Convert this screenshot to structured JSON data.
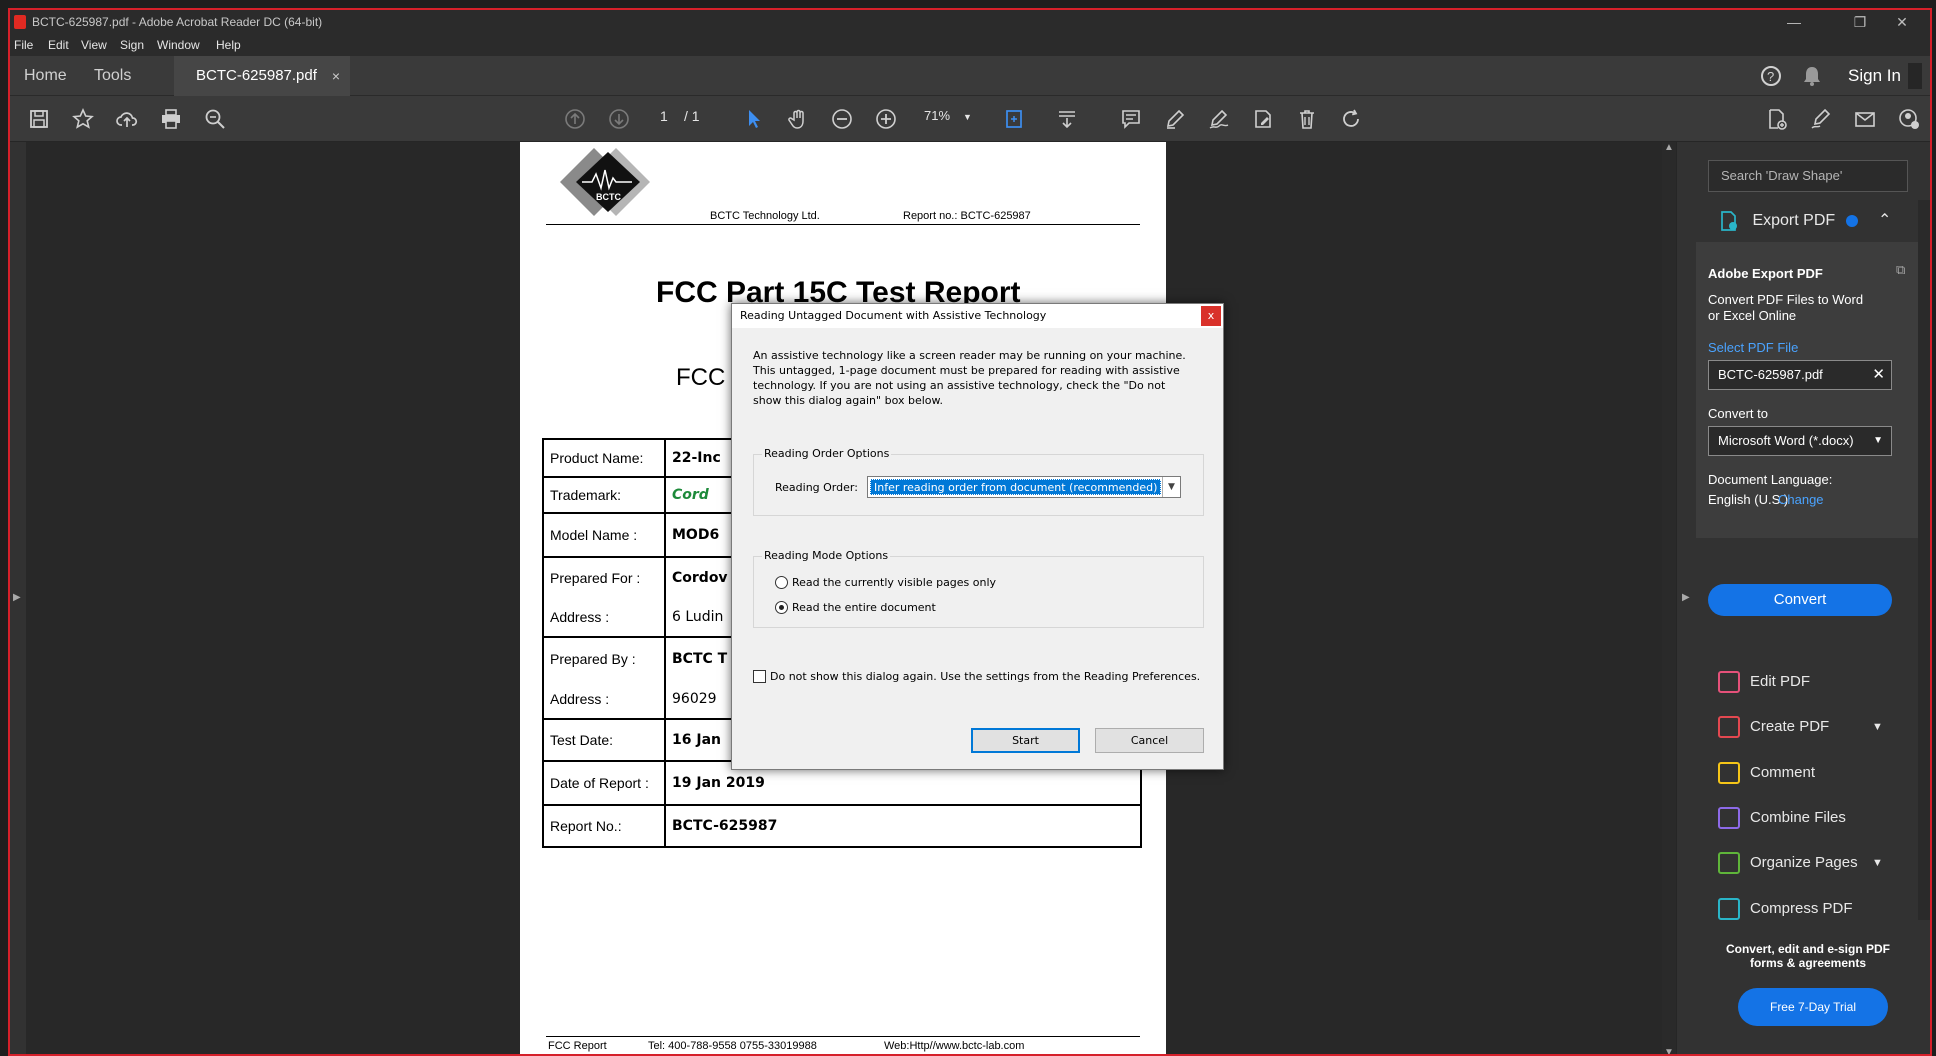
{
  "window": {
    "title": "BCTC-625987.pdf - Adobe Acrobat Reader DC (64-bit)",
    "controls": {
      "minimize": "—",
      "restore": "❐",
      "close": "✕"
    }
  },
  "menu": [
    "File",
    "Edit",
    "View",
    "Sign",
    "Window",
    "Help"
  ],
  "tabs": {
    "home": "Home",
    "tools": "Tools",
    "doc": "BCTC-625987.pdf",
    "close": "×"
  },
  "header": {
    "sign_in": "Sign In"
  },
  "toolbar": {
    "page_current": "1",
    "page_total": "/ 1",
    "zoom": "71%"
  },
  "document": {
    "logo_text": "BCTC",
    "company": "BCTC Technology Ltd.",
    "report_no_header": "Report no.: BCTC-625987",
    "title": "FCC Part 15C Test Report",
    "subtitle": "FCC",
    "rows": [
      {
        "label": "Product Name:",
        "value": "22-Inc"
      },
      {
        "label": "Trademark:",
        "value": "Cord"
      },
      {
        "label": "Model Name :",
        "value": "MOD6"
      },
      {
        "label": "Prepared For :",
        "value": "Cordov"
      },
      {
        "label": "Address :",
        "value": "6 Ludin"
      },
      {
        "label": "Prepared By :",
        "value": "BCTC T"
      },
      {
        "label": "Address :",
        "value": "96029"
      },
      {
        "label": "Test Date:",
        "value": "16 Jan"
      },
      {
        "label": "Date of Report :",
        "value": "19 Jan 2019"
      },
      {
        "label": "Report No.:",
        "value": "BCTC-625987"
      }
    ],
    "footer": {
      "left": "FCC Report",
      "tel": "Tel: 400-788-9558   0755-33019988",
      "web": "Web:Http//www.bctc-lab.com"
    }
  },
  "dialog": {
    "title": "Reading Untagged Document with Assistive Technology",
    "close": "x",
    "message": "An assistive technology like a screen reader may be running on your machine. This untagged, 1-page document must be prepared for reading with assistive technology. If you are not using an assistive technology, check the \"Do not show this dialog again\" box below.",
    "order_group": "Reading Order Options",
    "order_label": "Reading Order:",
    "order_value": "Infer reading order from document (recommended)",
    "mode_group": "Reading Mode Options",
    "mode_options": [
      "Read the currently visible pages only",
      "Read the entire document"
    ],
    "mode_selected": 1,
    "checkbox_label": "Do not show this dialog again. Use the settings from the Reading Preferences.",
    "start": "Start",
    "cancel": "Cancel"
  },
  "right_panel": {
    "search_placeholder": "Search 'Draw Shape'",
    "export_header": "Export PDF",
    "export_title": "Adobe Export PDF",
    "export_desc_1": "Convert PDF Files to Word",
    "export_desc_2": "or Excel Online",
    "select_file": "Select PDF File",
    "file_name": "BCTC-625987.pdf",
    "convert_to": "Convert to",
    "format": "Microsoft Word (*.docx)",
    "doc_lang_label": "Document Language:",
    "doc_lang_value": "English (U.S.)",
    "change": "Change",
    "convert_btn": "Convert",
    "tools": [
      "Edit PDF",
      "Create PDF",
      "Comment",
      "Combine Files",
      "Organize Pages",
      "Compress PDF"
    ],
    "promo": "Convert, edit and e-sign PDF forms & agreements",
    "trial": "Free 7-Day Trial"
  },
  "colors": {
    "accent": "#1473e6",
    "frame": "#d5202a",
    "edit": "#e5517a",
    "create": "#e34850",
    "comment": "#f5c518",
    "combine": "#8d6ae8",
    "organize": "#5fb53a",
    "compress": "#2ab5c8"
  }
}
